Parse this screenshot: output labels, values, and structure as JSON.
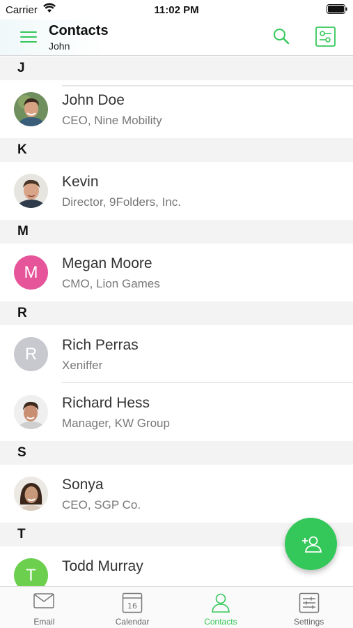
{
  "status_bar": {
    "carrier": "Carrier",
    "time": "11:02 PM"
  },
  "header": {
    "title": "Contacts",
    "subtitle": "John"
  },
  "colors": {
    "accent": "#34c759",
    "section_bg": "#f3f3f3",
    "avatar_megan": "#e6549a",
    "avatar_rich": "#c7c9cf",
    "avatar_todd": "#6ccf4e"
  },
  "sections": [
    {
      "letter": "J",
      "contacts": [
        {
          "name": "John Doe",
          "title": "CEO, Nine Mobility",
          "avatar": "photo"
        }
      ]
    },
    {
      "letter": "K",
      "contacts": [
        {
          "name": "Kevin",
          "title": "Director, 9Folders, Inc.",
          "avatar": "photo"
        }
      ]
    },
    {
      "letter": "M",
      "contacts": [
        {
          "name": "Megan Moore",
          "title": "CMO, Lion Games",
          "avatar": "initial",
          "initial": "M"
        }
      ]
    },
    {
      "letter": "R",
      "contacts": [
        {
          "name": "Rich Perras",
          "title": "Xeniffer",
          "avatar": "initial",
          "initial": "R"
        },
        {
          "name": "Richard Hess",
          "title": "Manager, KW Group",
          "avatar": "photo"
        }
      ]
    },
    {
      "letter": "S",
      "contacts": [
        {
          "name": "Sonya",
          "title": "CEO, SGP Co.",
          "avatar": "photo"
        }
      ]
    },
    {
      "letter": "T",
      "contacts": [
        {
          "name": "Todd Murray",
          "title": "",
          "avatar": "initial",
          "initial": "T"
        }
      ]
    }
  ],
  "tabs": [
    {
      "label": "Email",
      "icon": "envelope-icon"
    },
    {
      "label": "Calendar",
      "icon": "calendar-icon",
      "day": "16"
    },
    {
      "label": "Contacts",
      "icon": "person-icon",
      "active": true
    },
    {
      "label": "Settings",
      "icon": "sliders-icon"
    }
  ],
  "fab": {
    "icon": "add-person-icon"
  }
}
